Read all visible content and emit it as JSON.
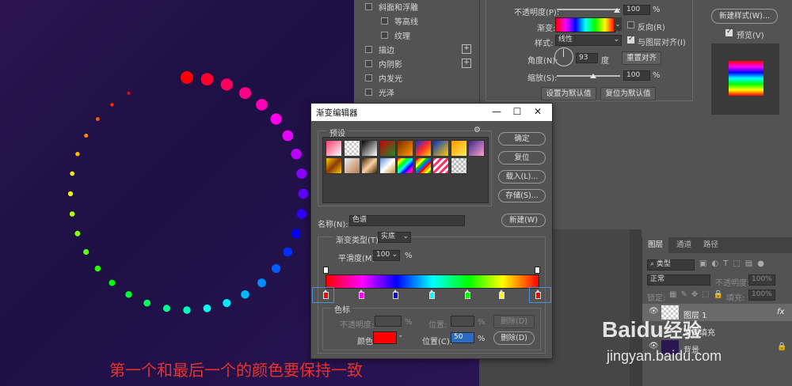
{
  "colors": {
    "accent_red": "#ff0000",
    "annotation": "#e8322c",
    "panel": "#535353",
    "dialog_title_bg": "#ffffff"
  },
  "style_list": {
    "items": [
      {
        "label": "斜面和浮雕",
        "checked": false,
        "indent": false,
        "has_plus": false
      },
      {
        "label": "等高线",
        "checked": false,
        "indent": true,
        "has_plus": false
      },
      {
        "label": "纹理",
        "checked": false,
        "indent": true,
        "has_plus": false
      },
      {
        "label": "描边",
        "checked": false,
        "indent": false,
        "has_plus": true
      },
      {
        "label": "内阴影",
        "checked": false,
        "indent": false,
        "has_plus": true
      },
      {
        "label": "内发光",
        "checked": false,
        "indent": false,
        "has_plus": false
      },
      {
        "label": "光泽",
        "checked": false,
        "indent": false,
        "has_plus": false
      }
    ]
  },
  "gradient_overlay": {
    "opacity_label": "不透明度(P):",
    "opacity_value": "100",
    "opacity_unit": "%",
    "gradient_label": "渐变:",
    "reverse_label": "反向(R)",
    "style_label": "样式:",
    "style_value": "线性",
    "align_label": "与图层对齐(I)",
    "angle_label": "角度(N):",
    "angle_value": "93",
    "angle_unit": "度",
    "reset_align_button": "重置对齐",
    "scale_label": "缩放(S):",
    "scale_value": "100",
    "scale_unit": "%",
    "set_default_button": "设置为默认值",
    "reset_default_button": "复位为默认值"
  },
  "side_buttons": {
    "new_style": "新建样式(W)...",
    "preview_label": "预览(V)"
  },
  "layers_panel": {
    "tabs": [
      "图层",
      "通道",
      "路径"
    ],
    "search_placeholder": "类型",
    "blend_mode": "正常",
    "opacity_label": "不透明度:",
    "opacity_value": "100%",
    "lock_label": "锁定:",
    "fill_label": "填充:",
    "fill_value": "100%",
    "layers": [
      {
        "name": "图层 1",
        "fx": "fx"
      },
      {
        "name": "渐变填充",
        "fx": ""
      },
      {
        "name": "背景",
        "fx": ""
      }
    ]
  },
  "dialog": {
    "title": "渐变编辑器",
    "minimize": "—",
    "maximize": "☐",
    "close": "✕",
    "presets_label": "预设",
    "buttons": {
      "ok": "确定",
      "reset": "复位",
      "load": "载入(L)...",
      "save": "存储(S)...",
      "new": "新建(W)",
      "delete1": "删除(D)",
      "delete2": "删除(D)"
    },
    "name_label": "名称(N):",
    "name_value": "色谱",
    "type_label": "渐变类型(T):",
    "type_value": "实底",
    "smooth_label": "平滑度(M):",
    "smooth_value": "100",
    "smooth_unit": "%",
    "color_stops_label": "色标",
    "stop_opacity_label": "不透明度:",
    "stop_opacity_unit": "%",
    "position_label": "位置:",
    "position_unit": "%",
    "color_label": "颜色:",
    "position_c_label": "位置(C):",
    "position_c_value": "50",
    "position_c_unit": "%",
    "selected_color": "#ff0000",
    "stops": [
      {
        "position": 0,
        "color": "#ff0000"
      },
      {
        "position": 17,
        "color": "#ff00ff"
      },
      {
        "position": 33,
        "color": "#0000ff"
      },
      {
        "position": 50,
        "color": "#00ffff"
      },
      {
        "position": 67,
        "color": "#00ff00"
      },
      {
        "position": 83,
        "color": "#ffff00"
      },
      {
        "position": 100,
        "color": "#ff0000"
      }
    ]
  },
  "annotation": "第一个和最后一个的颜色要保持一致",
  "watermark": {
    "brand_text": "Baidu",
    "brand_suffix": "经验",
    "url": "jingyan.baidu.com"
  }
}
